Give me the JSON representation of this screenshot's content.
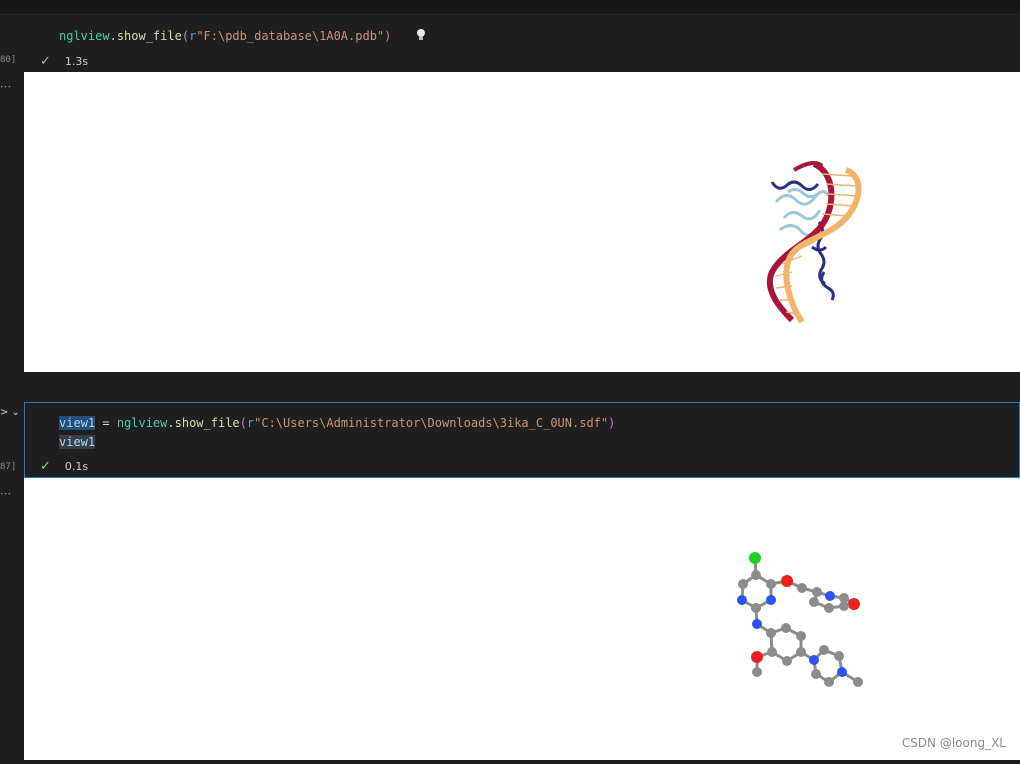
{
  "cells": [
    {
      "exec_count": "80]",
      "code_lines": [
        [
          {
            "t": "nglview",
            "c": "tok-id"
          },
          {
            "t": ".",
            "c": "tok-pl"
          },
          {
            "t": "show_file",
            "c": "tok-fn"
          },
          {
            "t": "(",
            "c": "tok-paren"
          },
          {
            "t": "r",
            "c": "tok-pre"
          },
          {
            "t": "\"F:\\pdb_database\\1A0A.pdb\"",
            "c": "tok-str"
          },
          {
            "t": ")",
            "c": "tok-paren"
          }
        ]
      ],
      "status_time": "1.3s"
    },
    {
      "exec_count": "87]",
      "code_lines": [
        [
          {
            "t": "view1",
            "c": "tok-var hl"
          },
          {
            "t": " = ",
            "c": "tok-pl"
          },
          {
            "t": "nglview",
            "c": "tok-id"
          },
          {
            "t": ".",
            "c": "tok-pl"
          },
          {
            "t": "show_file",
            "c": "tok-fn"
          },
          {
            "t": "(",
            "c": "tok-paren"
          },
          {
            "t": "r",
            "c": "tok-pre"
          },
          {
            "t": "\"C:\\Users\\Administrator\\Downloads\\3ika_C_0UN.sdf\"",
            "c": "tok-str"
          },
          {
            "t": ")",
            "c": "tok-paren"
          }
        ],
        [
          {
            "t": "view1",
            "c": "tok-var hl2"
          }
        ]
      ],
      "status_time": "0.1s"
    }
  ],
  "colors": {
    "dna_strand_a": "#f2b36b",
    "dna_strand_b": "#a8143c",
    "protein_light": "#9cc9d9",
    "protein_dark": "#2b2f85",
    "atom_carbon": "#8c8c8c",
    "atom_nitrogen": "#3050f8",
    "atom_oxygen": "#ee2020",
    "atom_chlorine": "#1ff01f"
  },
  "watermark": "CSDN @loong_XL"
}
